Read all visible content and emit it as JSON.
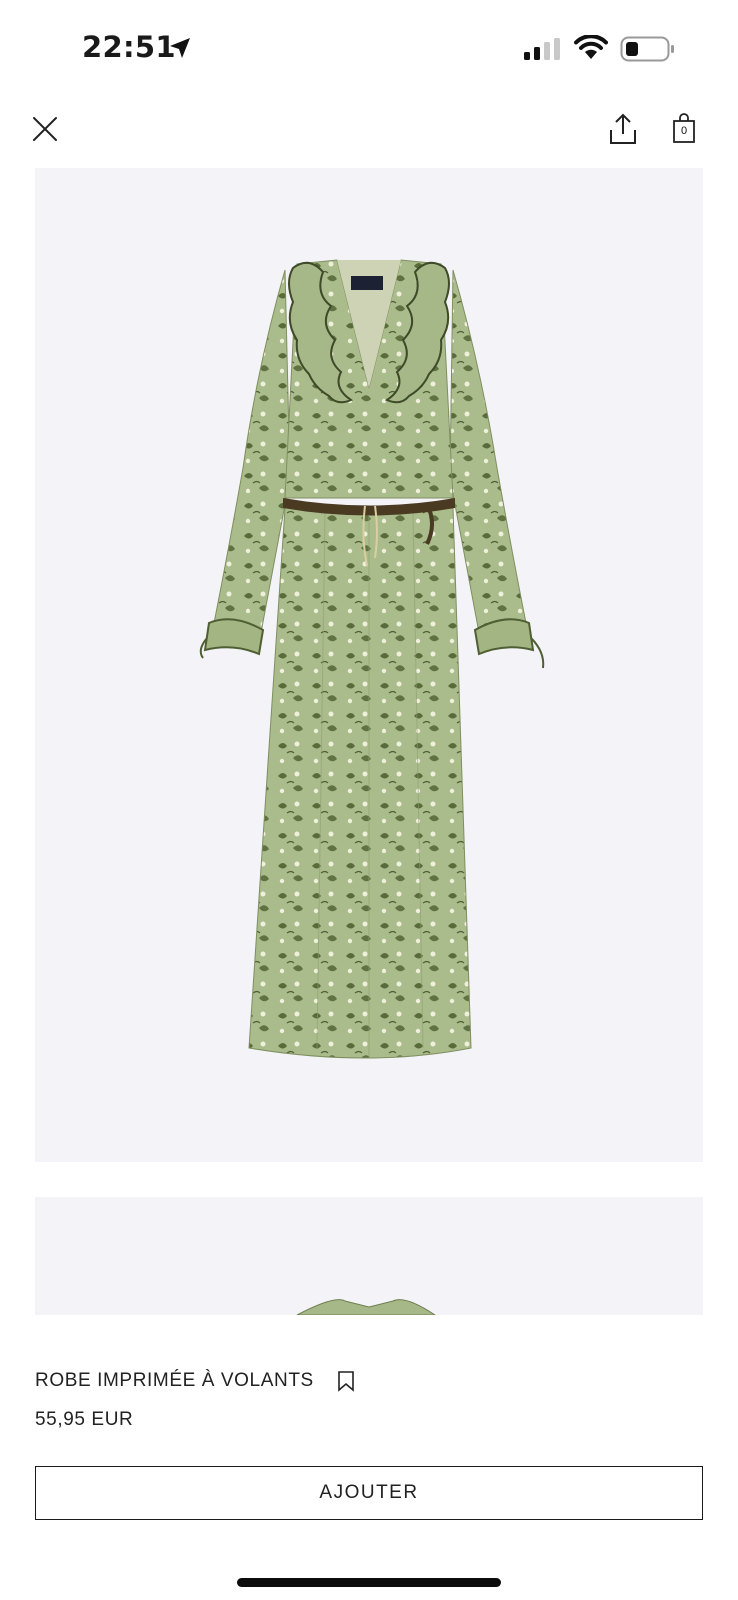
{
  "status_bar": {
    "time": "22:51",
    "icons": [
      "location-arrow-icon",
      "cellular-signal-icon",
      "wifi-icon",
      "battery-icon"
    ]
  },
  "nav": {
    "close_icon": "close-icon",
    "share_icon": "share-icon",
    "bag_icon": "shopping-bag-icon",
    "bag_count": "0"
  },
  "product": {
    "name": "ROBE IMPRIMÉE À VOLANTS",
    "price": "55,95 EUR",
    "add_button_label": "AJOUTER",
    "bookmark_icon": "bookmark-icon"
  },
  "colors": {
    "background": "#ffffff",
    "photo_background": "#f4f3f7",
    "dress_green": "#a6b887",
    "print_dark_green": "#4f5e33",
    "belt_brown": "#4a3a22",
    "text": "#1a1a1a"
  }
}
